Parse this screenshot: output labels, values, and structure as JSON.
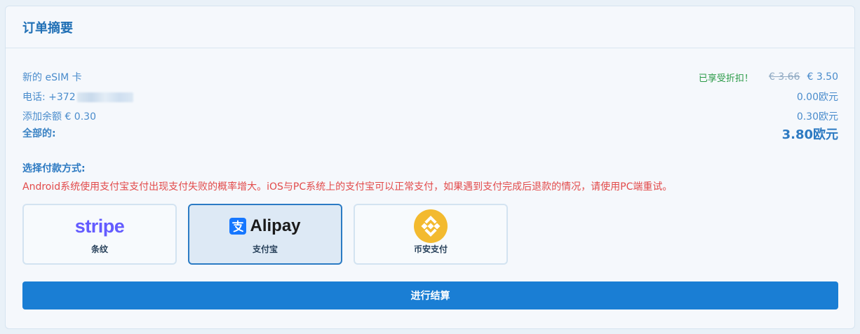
{
  "header": {
    "title": "订单摘要"
  },
  "summary": {
    "rows": [
      {
        "label": "新的 eSIM 卡",
        "discount_text": "已享受折扣！",
        "old_price": "€ 3.66",
        "price": "€ 3.50"
      },
      {
        "label": "电话: +372",
        "price": "0.00欧元"
      },
      {
        "label": "添加余额 € 0.30",
        "price": "0.30欧元"
      }
    ],
    "total": {
      "label": "全部的:",
      "value": "3.80欧元"
    }
  },
  "payment": {
    "label": "选择付款方式:",
    "warning": "Android系统使用支付宝支付出现支付失败的概率增大。iOS与PC系统上的支付宝可以正常支付，如果遇到支付完成后退款的情况，请使用PC端重试。",
    "methods": [
      {
        "logo_text": "stripe",
        "name": "条纹",
        "icon": "stripe-logo",
        "selected": false
      },
      {
        "logo_text": "Alipay",
        "name": "支付宝",
        "icon": "alipay-logo",
        "selected": true
      },
      {
        "logo_text": "",
        "name": "币安支付",
        "icon": "binance-logo",
        "selected": false
      }
    ]
  },
  "checkout": {
    "label": "进行结算"
  },
  "colors": {
    "accent": "#1a7ed4",
    "title": "#1f6fb5",
    "discount": "#2a9a47",
    "warning": "#e24a4a",
    "stripe": "#635bff",
    "alipay": "#1677ff",
    "binance": "#f3ba2f"
  }
}
